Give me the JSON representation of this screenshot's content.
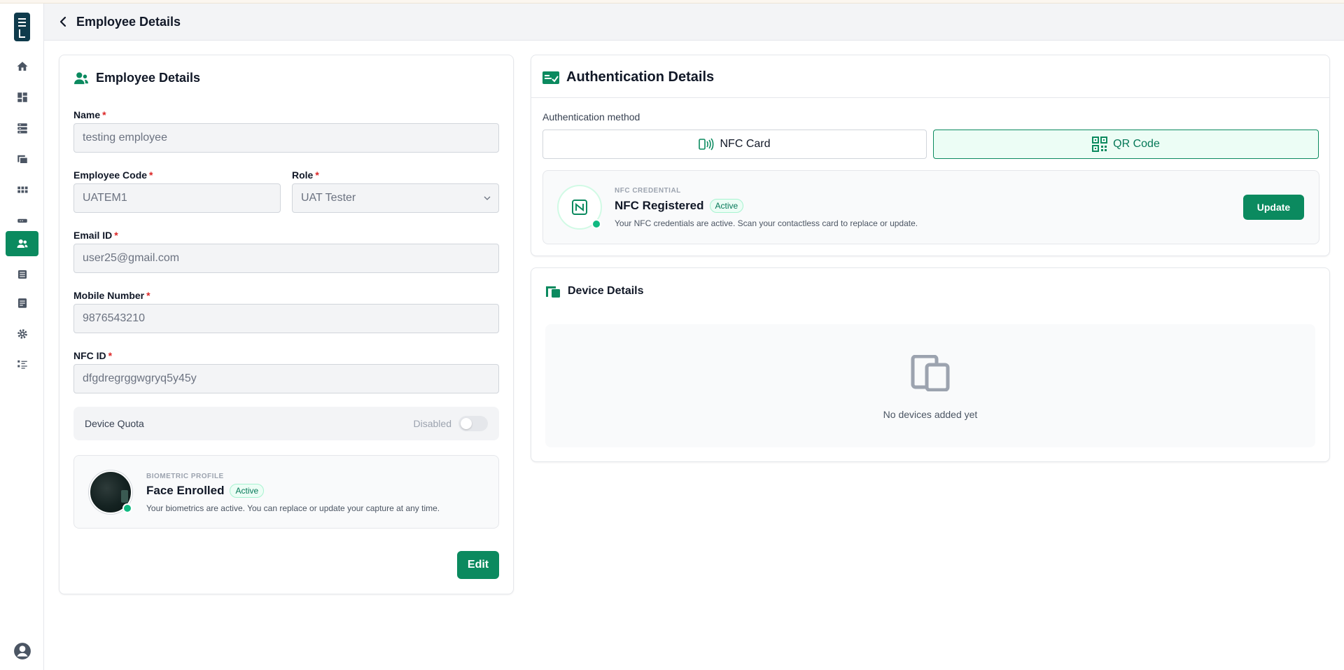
{
  "header": {
    "title": "Employee Details"
  },
  "sidebar": {
    "items": [
      {
        "icon": "home-icon"
      },
      {
        "icon": "dashboard-icon"
      },
      {
        "icon": "server-icon"
      },
      {
        "icon": "devices-icon"
      },
      {
        "icon": "grid-icon"
      },
      {
        "icon": "gateway-icon"
      },
      {
        "icon": "users-icon",
        "active": true
      },
      {
        "icon": "list-icon"
      },
      {
        "icon": "report-icon"
      },
      {
        "icon": "settings-icon"
      },
      {
        "icon": "checklist-icon"
      }
    ],
    "accent": "#0b8a5f"
  },
  "employee": {
    "title": "Employee Details",
    "required_mark": "*",
    "fields": {
      "name": {
        "label": "Name",
        "value": "testing employee"
      },
      "code": {
        "label": "Employee Code",
        "value": "UATEM1"
      },
      "role": {
        "label": "Role",
        "value": "UAT Tester"
      },
      "email": {
        "label": "Email ID",
        "value": "user25@gmail.com"
      },
      "mobile": {
        "label": "Mobile Number",
        "value": "9876543210"
      },
      "nfc": {
        "label": "NFC ID",
        "value": "dfgdregrggwgryq5y45y"
      }
    },
    "device_quota": {
      "label": "Device Quota",
      "status": "Disabled",
      "enabled": false
    },
    "biometric": {
      "caption": "BIOMETRIC PROFILE",
      "title": "Face Enrolled",
      "badge": "Active",
      "description": "Your biometrics are active. You can replace or update your capture at any time."
    },
    "edit_label": "Edit"
  },
  "auth": {
    "title": "Authentication Details",
    "method_label": "Authentication method",
    "methods": [
      {
        "label": "NFC Card",
        "selected": false
      },
      {
        "label": "QR Code",
        "selected": true
      }
    ],
    "credential": {
      "caption": "NFC CREDENTIAL",
      "title": "NFC Registered",
      "badge": "Active",
      "description": "Your NFC credentials are active. Scan your contactless card to replace or update.",
      "update_label": "Update"
    }
  },
  "devices": {
    "title": "Device Details",
    "empty_message": "No devices added yet"
  }
}
